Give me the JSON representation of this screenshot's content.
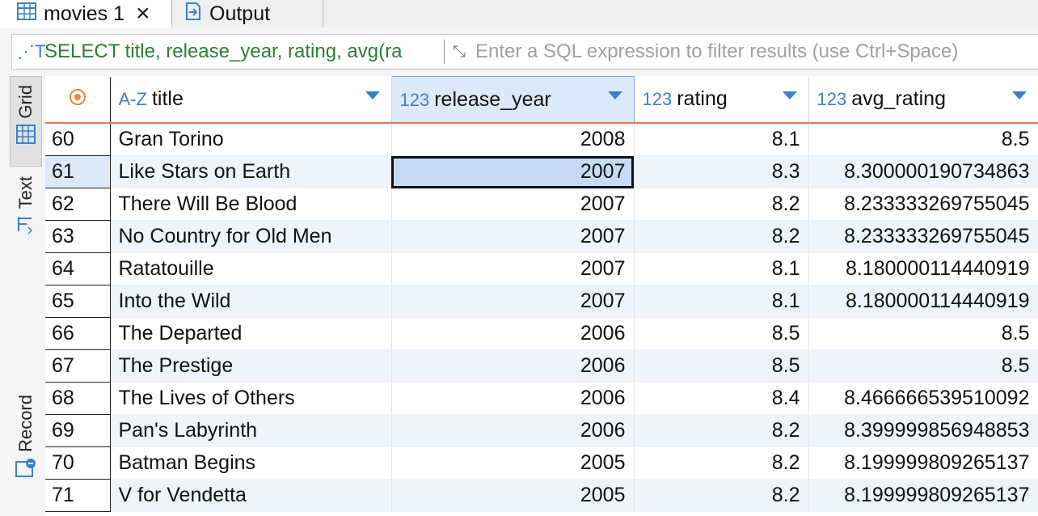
{
  "tabs": [
    {
      "label": "movies 1",
      "icon": "table-icon"
    },
    {
      "label": "Output",
      "icon": "output-icon"
    }
  ],
  "filter": {
    "sql": "SELECT title, release_year, rating, avg(ra",
    "placeholder": "Enter a SQL expression to filter results (use Ctrl+Space)"
  },
  "side_tabs": [
    "Grid",
    "Text",
    "Record"
  ],
  "columns": [
    {
      "type": "A-Z",
      "name": "title"
    },
    {
      "type": "123",
      "name": "release_year"
    },
    {
      "type": "123",
      "name": "rating"
    },
    {
      "type": "123",
      "name": "avg_rating"
    }
  ],
  "rows": [
    {
      "n": "60",
      "title": "Gran Torino",
      "year": "2008",
      "rating": "8.1",
      "avg": "8.5"
    },
    {
      "n": "61",
      "title": "Like Stars on Earth",
      "year": "2007",
      "rating": "8.3",
      "avg": "8.300000190734863"
    },
    {
      "n": "62",
      "title": "There Will Be Blood",
      "year": "2007",
      "rating": "8.2",
      "avg": "8.233333269755045"
    },
    {
      "n": "63",
      "title": "No Country for Old Men",
      "year": "2007",
      "rating": "8.2",
      "avg": "8.233333269755045"
    },
    {
      "n": "64",
      "title": "Ratatouille",
      "year": "2007",
      "rating": "8.1",
      "avg": "8.180000114440919"
    },
    {
      "n": "65",
      "title": "Into the Wild",
      "year": "2007",
      "rating": "8.1",
      "avg": "8.180000114440919"
    },
    {
      "n": "66",
      "title": "The Departed",
      "year": "2006",
      "rating": "8.5",
      "avg": "8.5"
    },
    {
      "n": "67",
      "title": "The Prestige",
      "year": "2006",
      "rating": "8.5",
      "avg": "8.5"
    },
    {
      "n": "68",
      "title": "The Lives of Others",
      "year": "2006",
      "rating": "8.4",
      "avg": "8.466666539510092"
    },
    {
      "n": "69",
      "title": "Pan's Labyrinth",
      "year": "2006",
      "rating": "8.2",
      "avg": "8.399999856948853"
    },
    {
      "n": "70",
      "title": "Batman Begins",
      "year": "2005",
      "rating": "8.2",
      "avg": "8.199999809265137"
    },
    {
      "n": "71",
      "title": "V for Vendetta",
      "year": "2005",
      "rating": "8.2",
      "avg": "8.199999809265137"
    }
  ],
  "selected_row": 1
}
